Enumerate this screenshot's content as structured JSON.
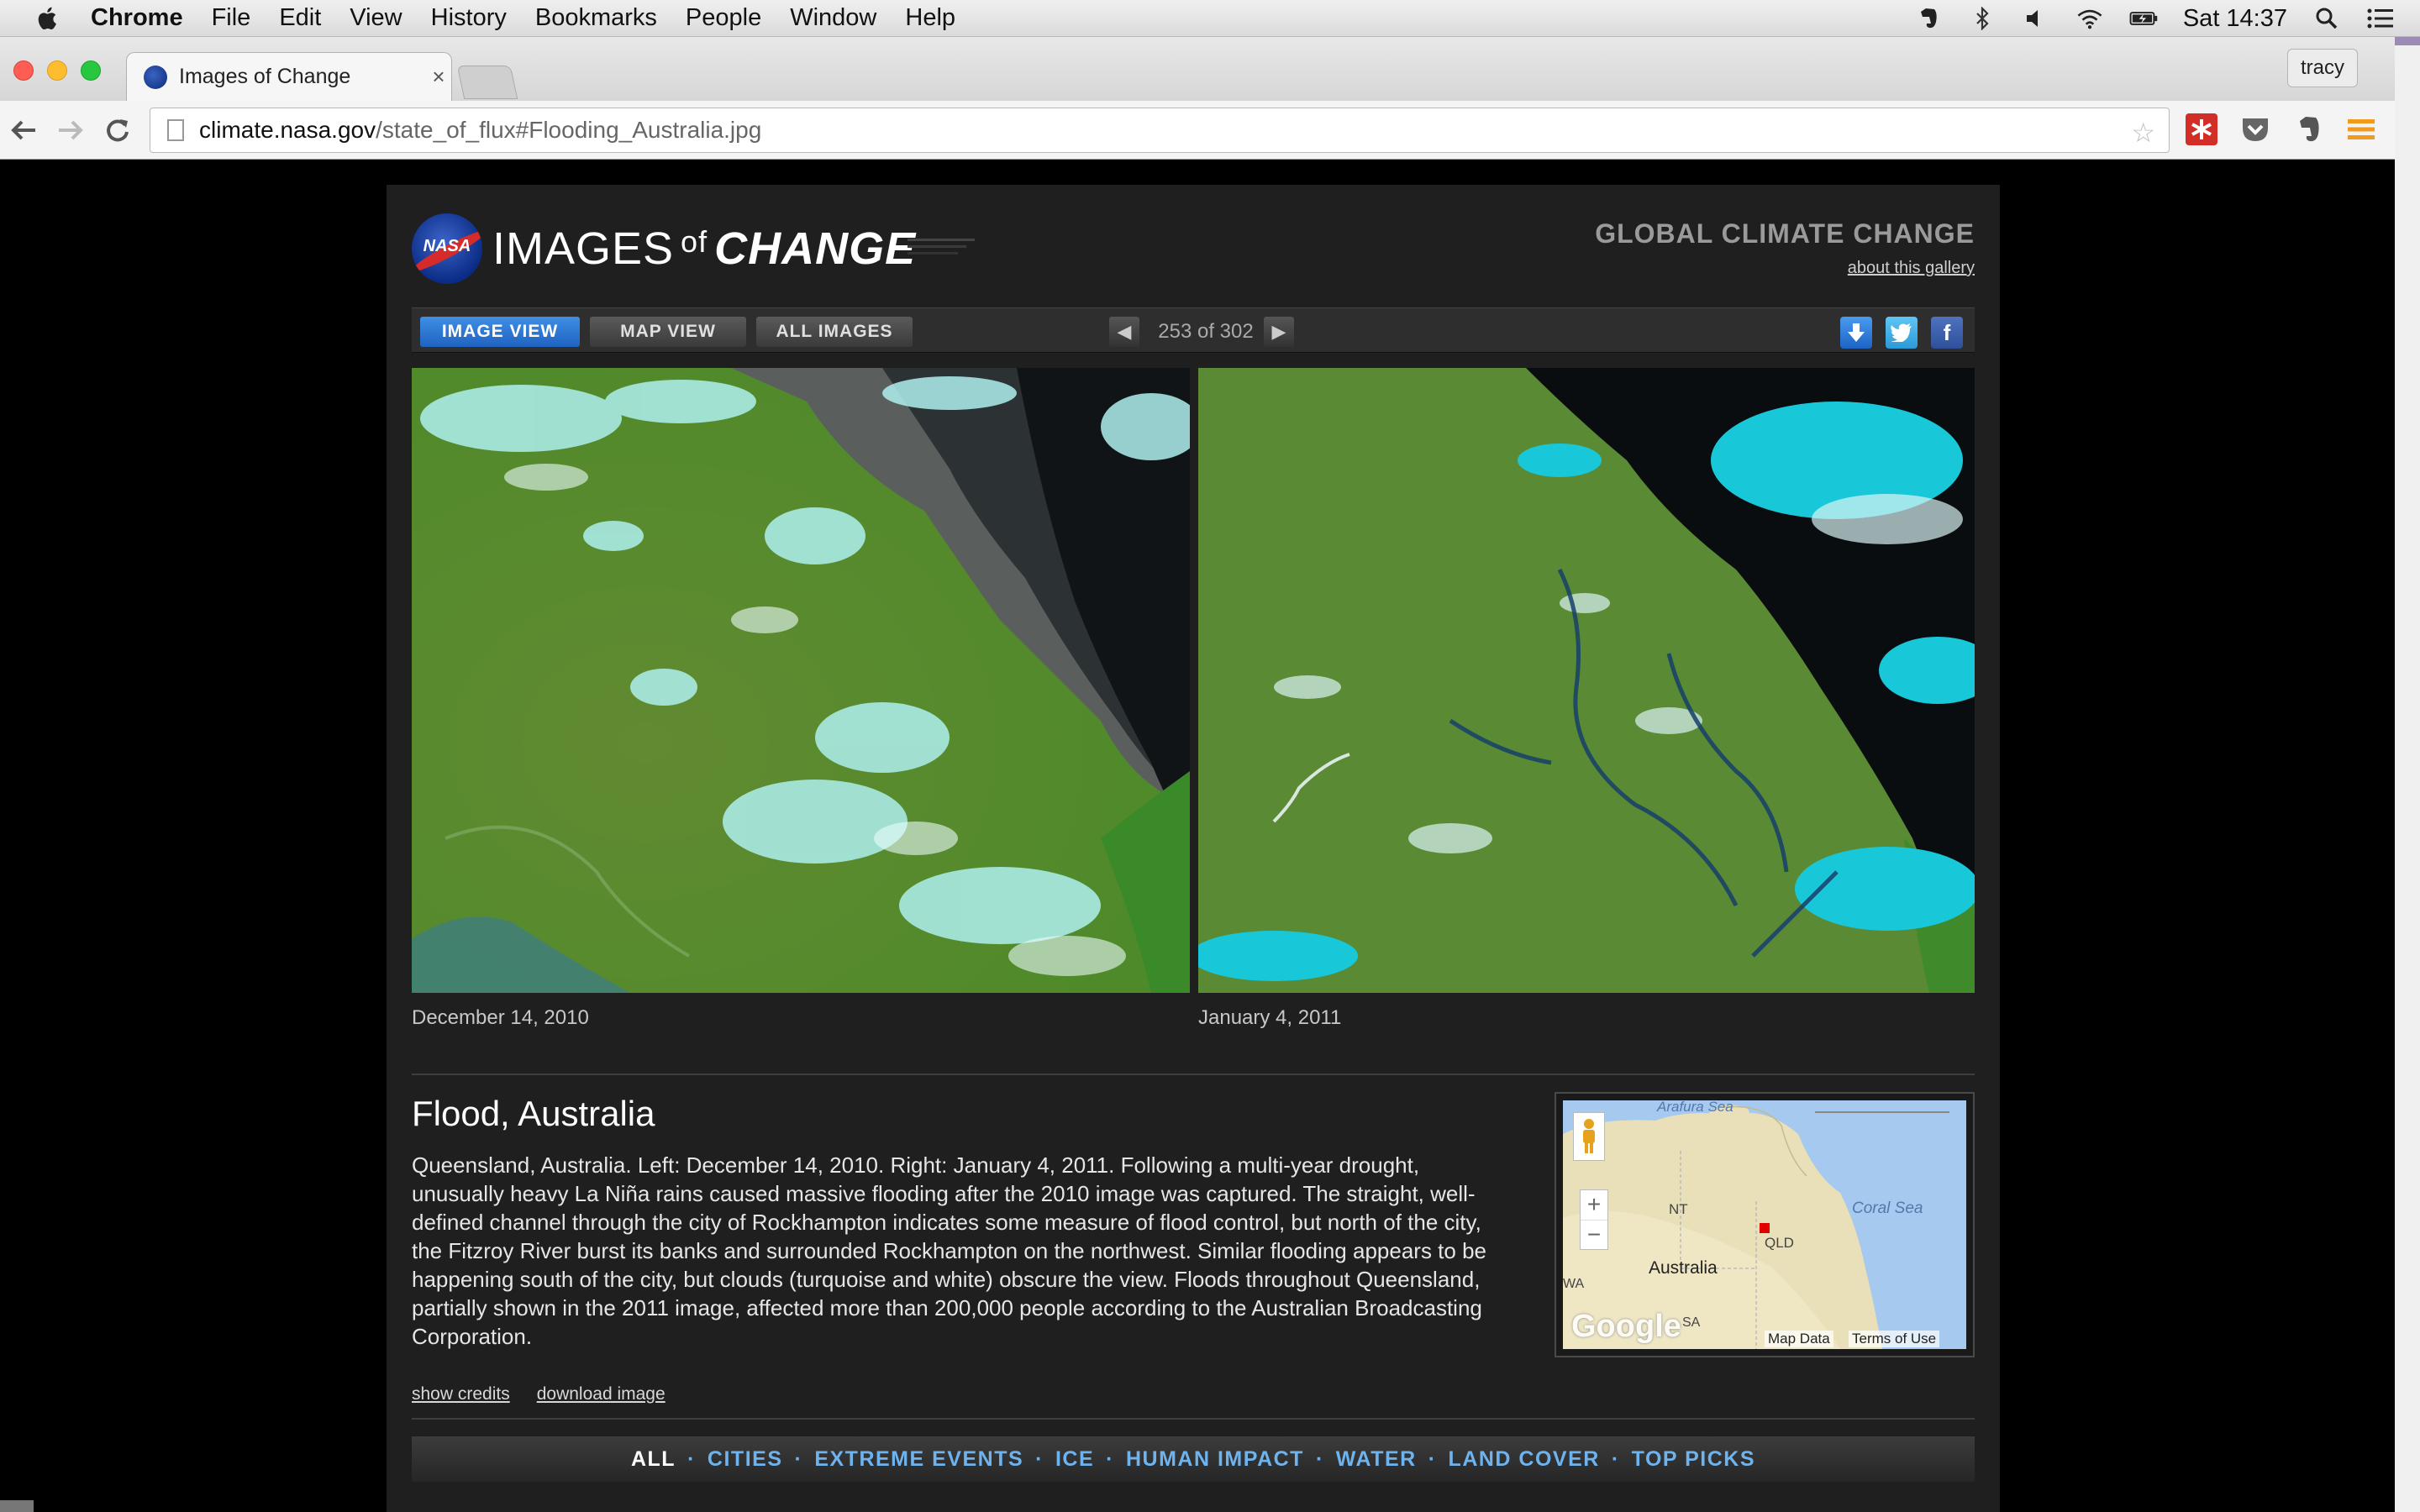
{
  "menubar": {
    "app": "Chrome",
    "items": [
      "File",
      "Edit",
      "View",
      "History",
      "Bookmarks",
      "People",
      "Window",
      "Help"
    ],
    "clock": "Sat 14:37"
  },
  "browser": {
    "tab_title": "Images of Change",
    "tab_close": "×",
    "profile": "tracy",
    "url_host": "climate.nasa.gov",
    "url_path": "/state_of_flux#Flooding_Australia.jpg"
  },
  "page": {
    "logo_nasa": "NASA",
    "logo_images": "IMAGES",
    "logo_of": "of",
    "logo_change": "CHANGE",
    "header_right": "GLOBAL CLIMATE CHANGE",
    "about_link": "about this gallery",
    "view_buttons": [
      "IMAGE VIEW",
      "MAP VIEW",
      "ALL IMAGES"
    ],
    "pager": "253 of 302",
    "caption_left": "December 14, 2010",
    "caption_right": "January 4, 2011",
    "title": "Flood, Australia",
    "description": "Queensland, Australia. Left: December 14, 2010. Right: January 4, 2011. Following a multi-year drought, unusually heavy La Niña rains caused massive flooding after the 2010 image was captured. The straight, well-defined channel through the city of Rockhampton indicates some measure of flood control, but north of the city, the Fitzroy River burst its banks and surrounded Rockhampton on the northwest. Similar flooding appears to be happening south of the city, but clouds (turquoise and white) obscure the view. Floods throughout Queensland, partially shown in the 2011 image, affected more than 200,000 people according to the Australian Broadcasting Corporation.",
    "link_credits": "show credits",
    "link_download": "download image",
    "map": {
      "label_arafura": "Arafura Sea",
      "label_nt": "NT",
      "label_qld": "QLD",
      "label_coral": "Coral Sea",
      "label_australia": "Australia",
      "label_wa": "WA",
      "label_sa": "SA",
      "google": "Google",
      "map_data": "Map Data",
      "terms": "Terms of Use",
      "zoom_in": "+",
      "zoom_out": "−"
    },
    "categories": [
      "ALL",
      "CITIES",
      "EXTREME EVENTS",
      "ICE",
      "HUMAN IMPACT",
      "WATER",
      "LAND COVER",
      "TOP PICKS"
    ]
  }
}
